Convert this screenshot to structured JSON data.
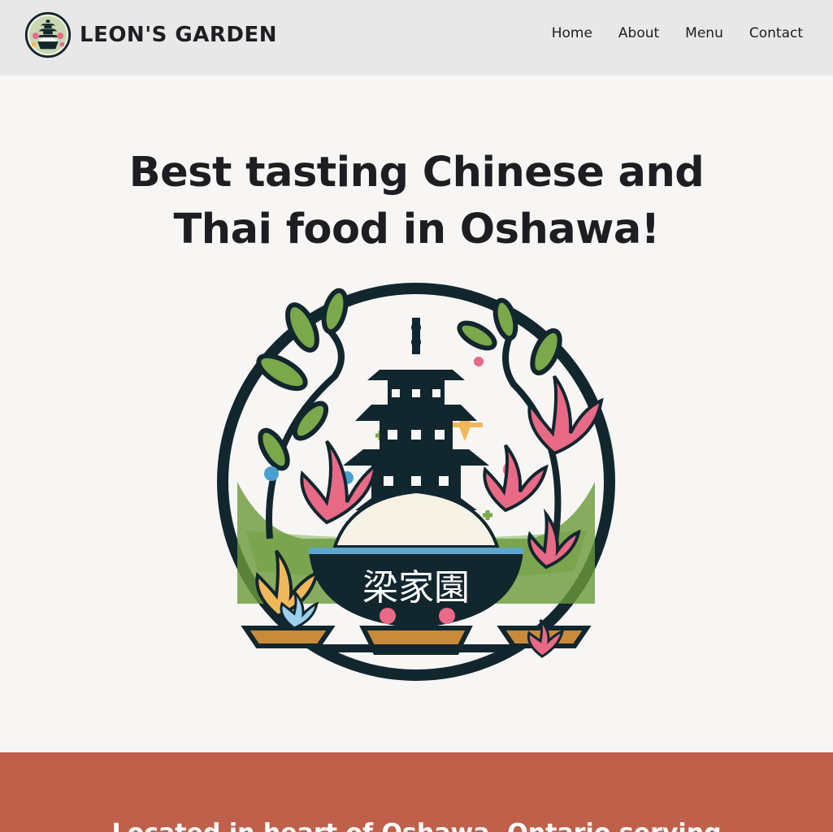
{
  "header": {
    "brand_name": "LEON'S GARDEN",
    "logo_icon": "pagoda-rice-bowl-logo",
    "nav": [
      {
        "label": "Home"
      },
      {
        "label": "About"
      },
      {
        "label": "Menu"
      },
      {
        "label": "Contact"
      }
    ]
  },
  "hero": {
    "title": "Best tasting Chinese and Thai food in Oshawa!",
    "logo_icon": "pagoda-rice-bowl-logo",
    "bowl_text": "梁家園"
  },
  "band": {
    "text": "Located in heart of Oshawa, Ontario serving"
  },
  "colors": {
    "header_bg": "#e8e8e8",
    "page_bg": "#f7f6f5",
    "band_bg": "#bf604a",
    "text": "#1e1e22",
    "logo_ring": "#12262e",
    "lotus_pink": "#e86a86",
    "leaf_green": "#6a9a3a"
  }
}
